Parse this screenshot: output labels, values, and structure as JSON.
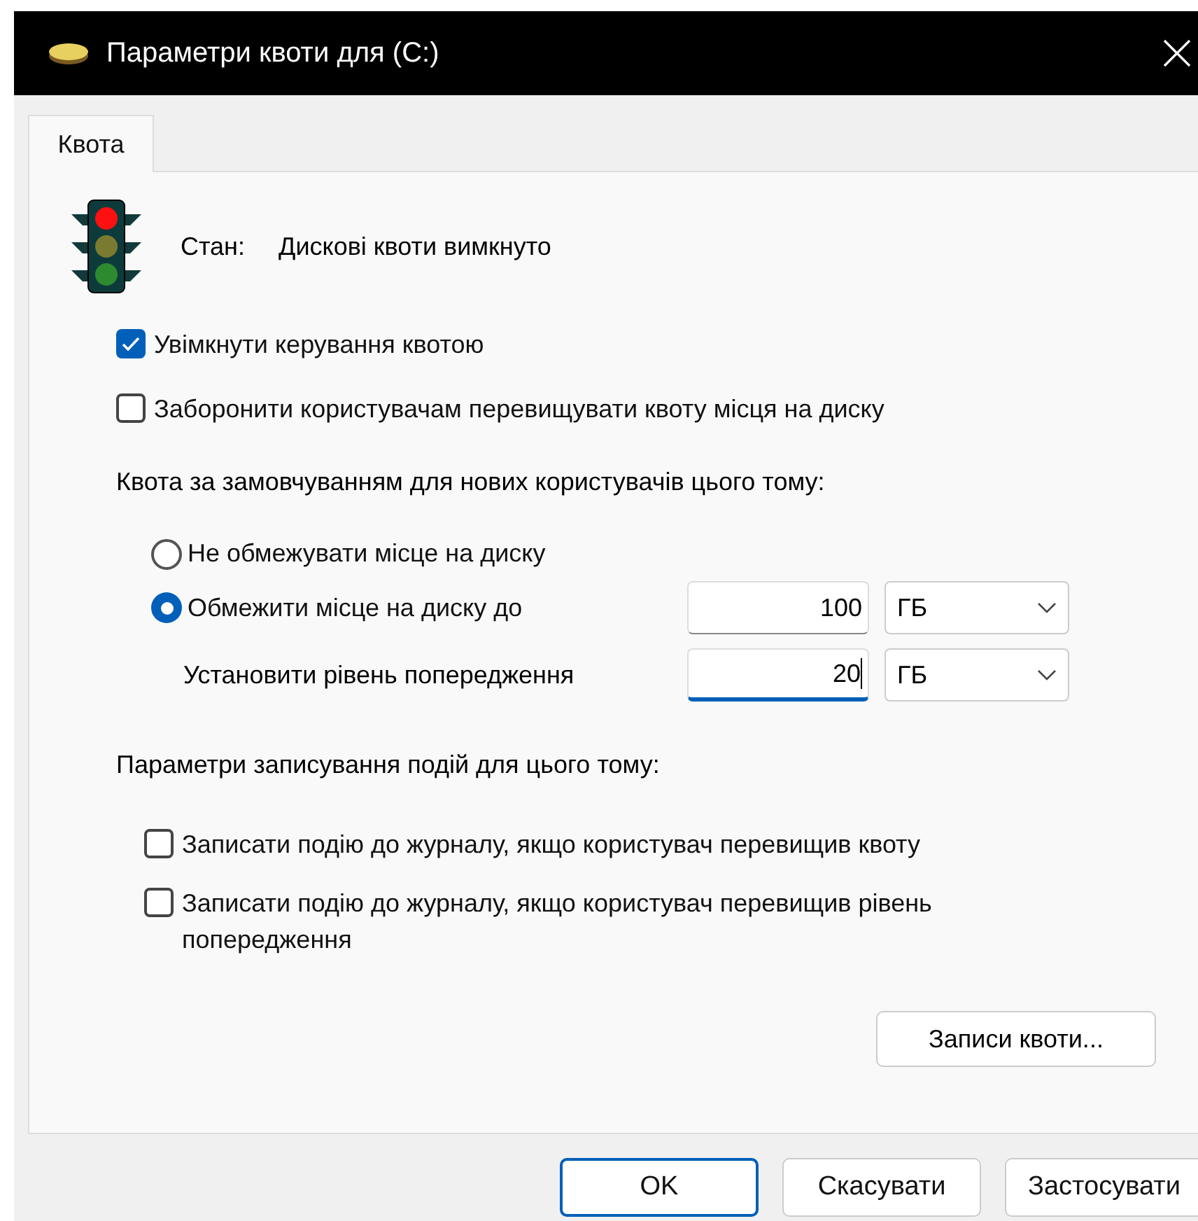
{
  "window": {
    "title": "Параметри квоти для  (C:)"
  },
  "tabs": [
    {
      "label": "Квота",
      "selected": true
    }
  ],
  "status": {
    "label": "Стан:",
    "value": "Дискові квоти вимкнуто"
  },
  "options": [
    {
      "label": "Увімкнути керування квотою",
      "checked": true
    },
    {
      "label": "Заборонити користувачам перевищувати квоту місця на диску",
      "checked": false
    }
  ],
  "default_quota": {
    "heading": "Квота за замовчуванням для нових користувачів цього тому:",
    "choices": [
      {
        "label": "Не обмежувати місце на диску",
        "selected": false
      },
      {
        "label": "Обмежити місце на диску до",
        "selected": true
      }
    ],
    "limit": {
      "value": "100",
      "unit": "ГБ",
      "focused": false
    },
    "warning": {
      "label": "Установити рівень попередження",
      "value": "20",
      "unit": "ГБ",
      "focused": true
    }
  },
  "logging": {
    "heading": "Параметри записування подій для цього тому:",
    "options": [
      {
        "label": "Записати подію до журналу, якщо користувач перевищив квоту",
        "checked": false
      },
      {
        "label": "Записати подію до журналу, якщо користувач перевищив рівень попередження",
        "checked": false
      }
    ]
  },
  "entries_button": "Записи квоти...",
  "buttons": [
    {
      "label": "OK",
      "default": true
    },
    {
      "label": "Скасувати",
      "default": false
    },
    {
      "label": "Застосувати",
      "default": false
    }
  ]
}
